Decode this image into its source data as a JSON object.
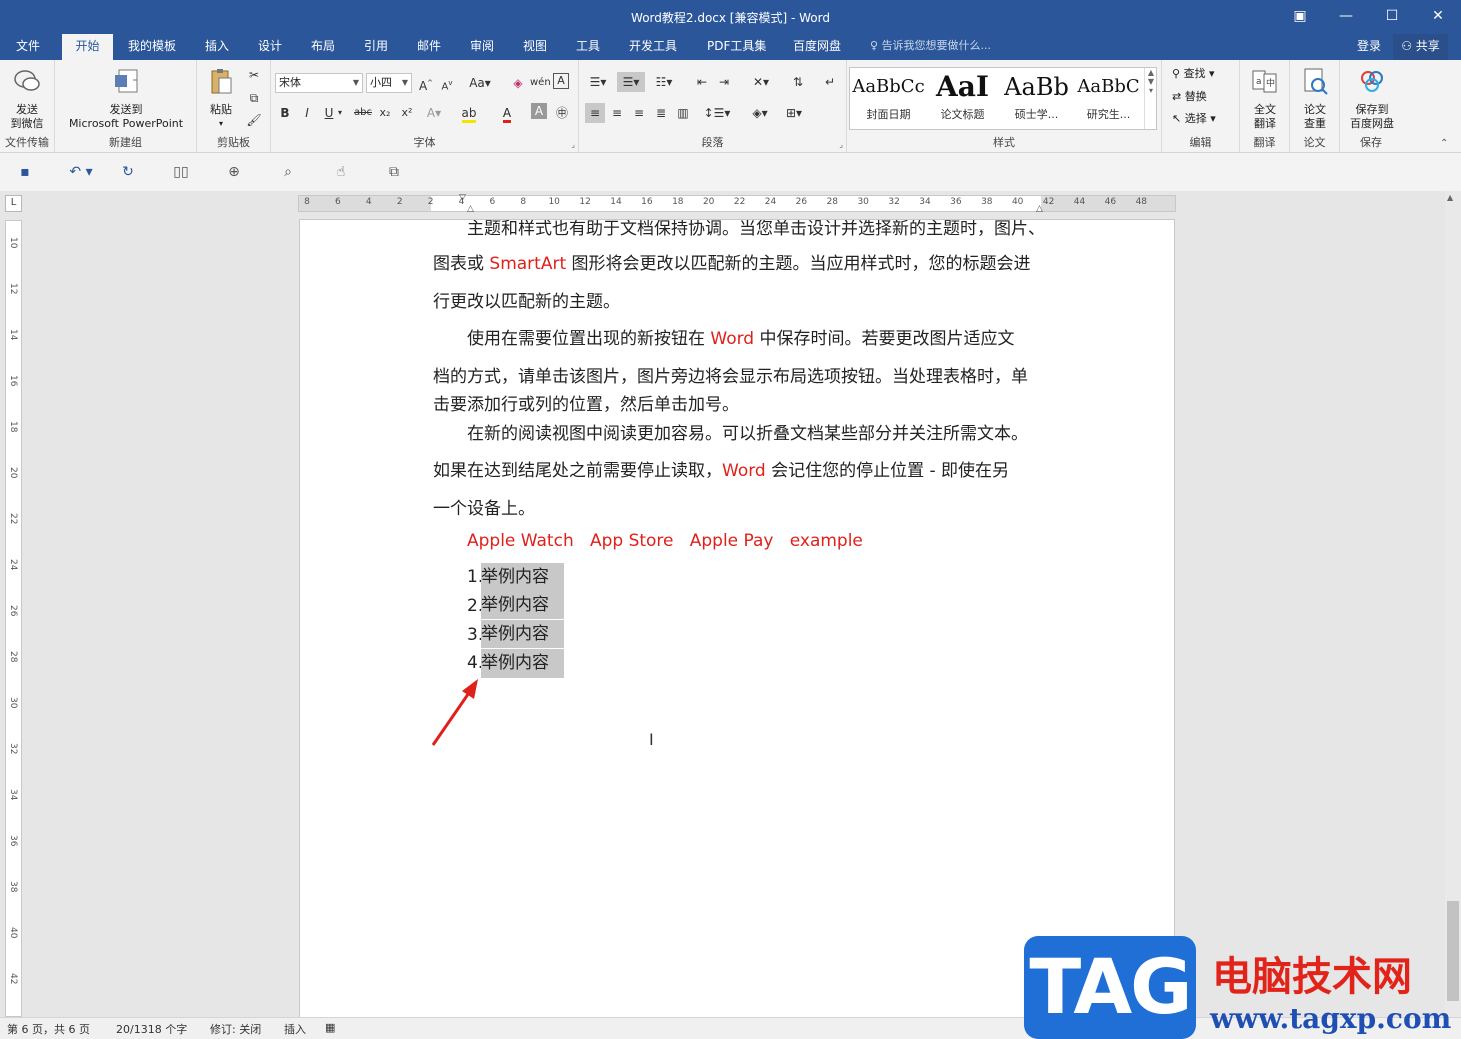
{
  "window": {
    "title": "Word教程2.docx [兼容模式] - Word"
  },
  "tabs": [
    "文件",
    "开始",
    "我的模板",
    "插入",
    "设计",
    "布局",
    "引用",
    "邮件",
    "审阅",
    "视图",
    "工具",
    "开发工具",
    "PDF工具集",
    "百度网盘"
  ],
  "active_tab": "开始",
  "tell_me": "告诉我您想要做什么...",
  "login": "登录",
  "share": "共享",
  "ribbon": {
    "send_wechat": "发送\n到微信",
    "send_wechat_l1": "发送",
    "send_wechat_l2": "到微信",
    "file_transfer": "文件传输",
    "send_ppt_l1": "发送到",
    "send_ppt_l2": "Microsoft PowerPoint",
    "new_group": "新建组",
    "paste": "粘贴",
    "clipboard": "剪贴板",
    "font_name": "宋体",
    "font_size": "小四",
    "font_group": "字体",
    "paragraph_group": "段落",
    "styles": [
      {
        "sample": "AaBbCc",
        "name": "封面日期"
      },
      {
        "sample": "AaI",
        "name": "论文标题"
      },
      {
        "sample": "AaBb",
        "name": "硕士学..."
      },
      {
        "sample": "AaBbC",
        "name": "研究生..."
      }
    ],
    "styles_group": "样式",
    "find": "查找",
    "replace": "替换",
    "select": "选择",
    "edit_group": "编辑",
    "translate_l1": "全文",
    "translate_l2": "翻译",
    "translate_group": "翻译",
    "paper_l1": "论文",
    "paper_l2": "查重",
    "paper_group": "论文",
    "save_baidu_l1": "保存到",
    "save_baidu_l2": "百度网盘",
    "save_group": "保存"
  },
  "ruler": {
    "h_ticks": [
      "8",
      "6",
      "4",
      "2",
      "2",
      "4",
      "6",
      "8",
      "10",
      "12",
      "14",
      "16",
      "18",
      "20",
      "22",
      "24",
      "26",
      "28",
      "30",
      "32",
      "34",
      "36",
      "38",
      "40",
      "42",
      "44",
      "46",
      "48"
    ],
    "v_ticks": [
      "10",
      "12",
      "14",
      "16",
      "18",
      "20",
      "22",
      "24",
      "26",
      "28",
      "30",
      "32",
      "34",
      "36",
      "38",
      "40",
      "42"
    ]
  },
  "document": {
    "line0": "主题和样式也有助于文档保持协调。当您单击设计并选择新的主题时，图片、",
    "line1_a": "图表或 ",
    "line1_red": "SmartArt",
    "line1_b": " 图形将会更改以匹配新的主题。当应用样式时，您的标题会进",
    "line2": "行更改以匹配新的主题。",
    "line3_a": "使用在需要位置出现的新按钮在 ",
    "line3_red": "Word",
    "line3_b": " 中保存时间。若要更改图片适应文",
    "line4": "档的方式，请单击该图片，图片旁边将会显示布局选项按钮。当处理表格时，单",
    "line5": "击要添加行或列的位置，然后单击加号。",
    "line6": "在新的阅读视图中阅读更加容易。可以折叠文档某些部分并关注所需文本。",
    "line7_a": "如果在达到结尾处之前需要停止读取，",
    "line7_red": "Word",
    "line7_b": " 会记住您的停止位置 - 即使在另",
    "line8": "一个设备上。",
    "red_words": [
      "Apple Watch",
      "App Store",
      "Apple Pay",
      "example"
    ],
    "list": [
      {
        "num": "1.",
        "text": "举例内容"
      },
      {
        "num": "2.",
        "text": "举例内容"
      },
      {
        "num": "3.",
        "text": "举例内容"
      },
      {
        "num": "4.",
        "text": "举例内容"
      }
    ]
  },
  "status": {
    "page": "第 6 页，共 6 页",
    "words": "20/1318 个字",
    "track": "修订: 关闭",
    "insert": "插入"
  },
  "watermark": {
    "tag": "TAG",
    "cn": "电脑技术网",
    "url": "www.tagxp.com"
  },
  "colors": {
    "accent": "#2b579a",
    "red_text": "#e0201a",
    "arrow": "#e0201a"
  }
}
